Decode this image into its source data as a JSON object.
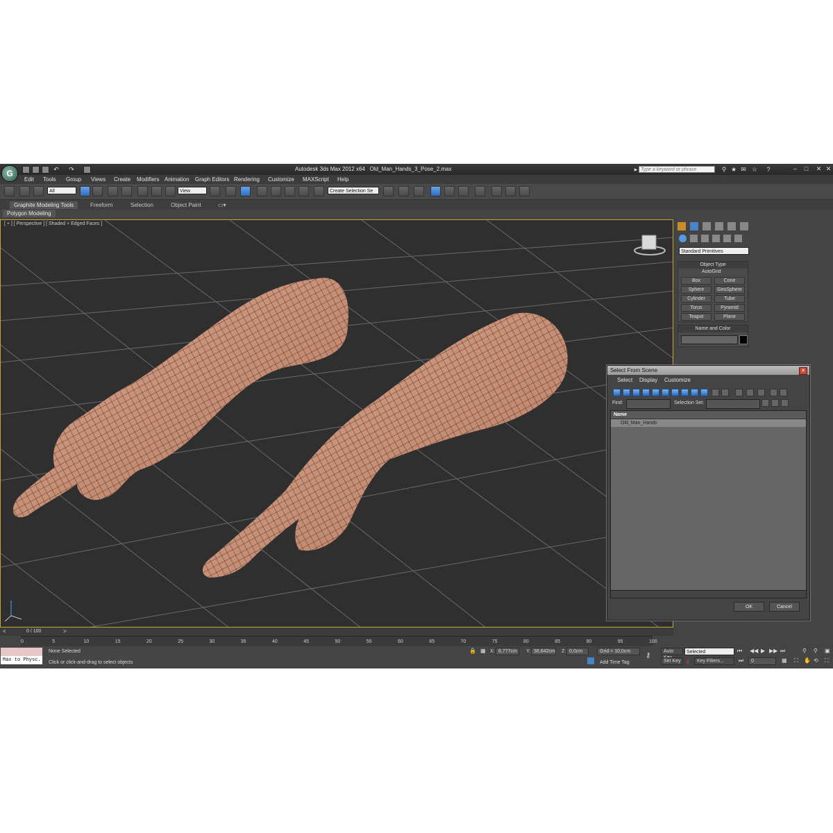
{
  "title": {
    "app": "Autodesk 3ds Max  2012 x64",
    "file": "Old_Man_Hands_3_Pose_2.max",
    "search_placeholder": "Type a keyword or phrase"
  },
  "menu": [
    "Edit",
    "Tools",
    "Group",
    "Views",
    "Create",
    "Modifiers",
    "Animation",
    "Graph Editors",
    "Rendering",
    "Customize",
    "MAXScript",
    "Help"
  ],
  "toolbar": {
    "filter_value": "All",
    "coord_value": "View",
    "selection_set": "Create Selection Se"
  },
  "ribbon": {
    "tabs": [
      "Graphite Modeling Tools",
      "Freeform",
      "Selection",
      "Object Paint"
    ],
    "sub_tab": "Polygon Modeling"
  },
  "viewport": {
    "label": "[ + ] [ Perspective ] [ Shaded + Edged Faces ]"
  },
  "command_panel": {
    "category": "Standard Primitives",
    "object_type_title": "Object Type",
    "autogrid_label": "AutoGrid",
    "buttons": [
      "Box",
      "Cone",
      "Sphere",
      "GeoSphere",
      "Cylinder",
      "Tube",
      "Torus",
      "Pyramid",
      "Teapot",
      "Plane"
    ],
    "name_color_title": "Name and Color"
  },
  "dialog": {
    "title": "Select From Scene",
    "menu": [
      "Select",
      "Display",
      "Customize"
    ],
    "find_label": "Find:",
    "selection_set_label": "Selection Set:",
    "column_header": "Name",
    "items": [
      "Old_Man_Hands"
    ],
    "ok_label": "OK",
    "cancel_label": "Cancel"
  },
  "timeline": {
    "frame_counter": "0 / 100",
    "ticks": [
      "0",
      "5",
      "10",
      "15",
      "20",
      "25",
      "30",
      "35",
      "40",
      "45",
      "50",
      "55",
      "60",
      "65",
      "70",
      "75",
      "80",
      "85",
      "90",
      "95",
      "100"
    ]
  },
  "status": {
    "maxscript_listener": "Max to Physc.",
    "selection_text": "None Selected",
    "prompt_text": "Click or click-and-drag to select objects",
    "x_label": "X:",
    "x_value": "6,777cm",
    "y_label": "Y:",
    "y_value": "36,642cm",
    "z_label": "Z:",
    "z_value": "0,0cm",
    "grid_text": "Grid = 10,0cm",
    "add_time_tag": "Add Time Tag",
    "auto_key": "Auto Key",
    "set_key": "Set Key",
    "key_mode": "Selected",
    "key_filters": "Key Filters...",
    "frame_value": "0"
  },
  "colors": {
    "viewport_bg": "#2f2f2f",
    "grid": "#6a6a6a",
    "skin": "#c7937a",
    "accent": "#2f6cbf",
    "active_border": "#c9a632"
  }
}
